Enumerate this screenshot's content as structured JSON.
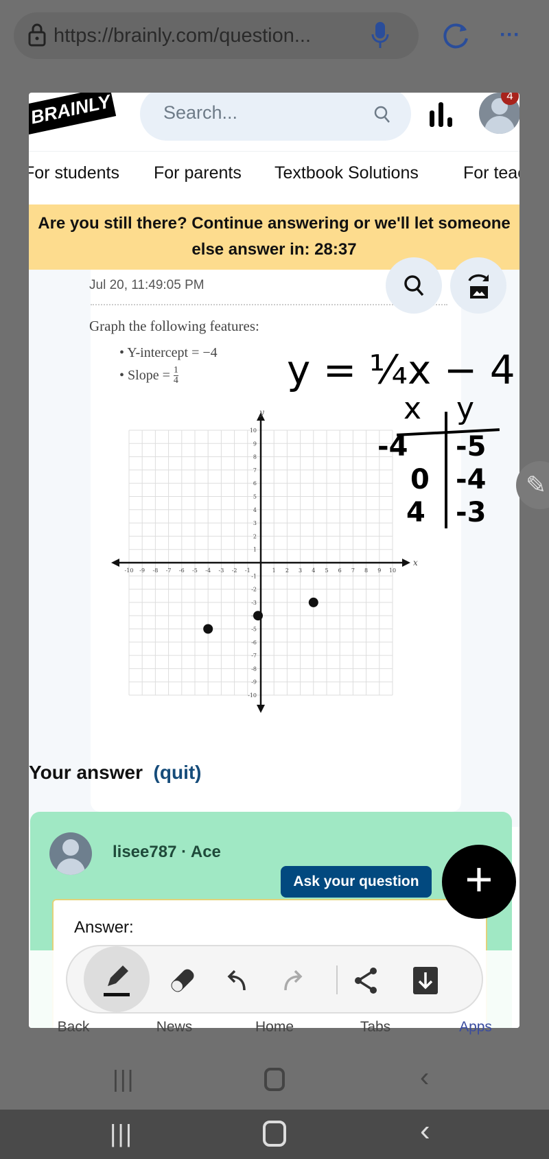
{
  "browser": {
    "url": "https://brainly.com/question...",
    "bottom_nav": [
      {
        "label": "Back"
      },
      {
        "label": "News"
      },
      {
        "label": "Home"
      },
      {
        "label": "Tabs"
      },
      {
        "label": "Apps"
      }
    ]
  },
  "header": {
    "logo": "BRAINLY",
    "search_placeholder": "Search...",
    "notification_count": "4"
  },
  "nav": [
    "For students",
    "For parents",
    "Textbook Solutions",
    "For teachers"
  ],
  "banner": {
    "text": "Are you still there? Continue answering or we'll let someone else answer in: 28:37"
  },
  "question": {
    "timestamp": "Jul 20, 11:49:05 PM",
    "prompt": "Graph the following features:",
    "bullets": [
      "Y-intercept = −4",
      "Slope = "
    ],
    "slope_num": "1",
    "slope_den": "4"
  },
  "handwriting": {
    "equation": "y = ¼x − 4",
    "x_header": "x",
    "y_header": "y",
    "x_values": [
      "-4",
      "0",
      "4"
    ],
    "y_values": [
      "-5",
      "-4",
      "-3"
    ]
  },
  "chart_data": {
    "type": "scatter",
    "xlabel": "x",
    "ylabel": "y",
    "xlim": [
      -10,
      10
    ],
    "ylim": [
      -10,
      10
    ],
    "grid": true,
    "xticks": [
      -10,
      -9,
      -8,
      -7,
      -6,
      -5,
      -4,
      -3,
      -2,
      -1,
      1,
      2,
      3,
      4,
      5,
      6,
      7,
      8,
      9,
      10
    ],
    "yticks": [
      10,
      9,
      8,
      7,
      6,
      5,
      4,
      3,
      2,
      1,
      -1,
      -2,
      -3,
      -4,
      -5,
      -6,
      -7,
      -8,
      -9,
      -10
    ],
    "points": [
      {
        "x": -4,
        "y": -5
      },
      {
        "x": 0,
        "y": -4
      },
      {
        "x": 4,
        "y": -3
      }
    ]
  },
  "answer": {
    "heading": "Your answer",
    "quit": "(quit)",
    "user": "lisee787",
    "rank": "Ace",
    "label": "Answer:",
    "ask_button": "Ask your question"
  },
  "colors": {
    "banner": "#fddc8e",
    "answer_card": "#a0e8c4",
    "ask_button": "#02497f",
    "apps_active": "#3a4ca0"
  }
}
